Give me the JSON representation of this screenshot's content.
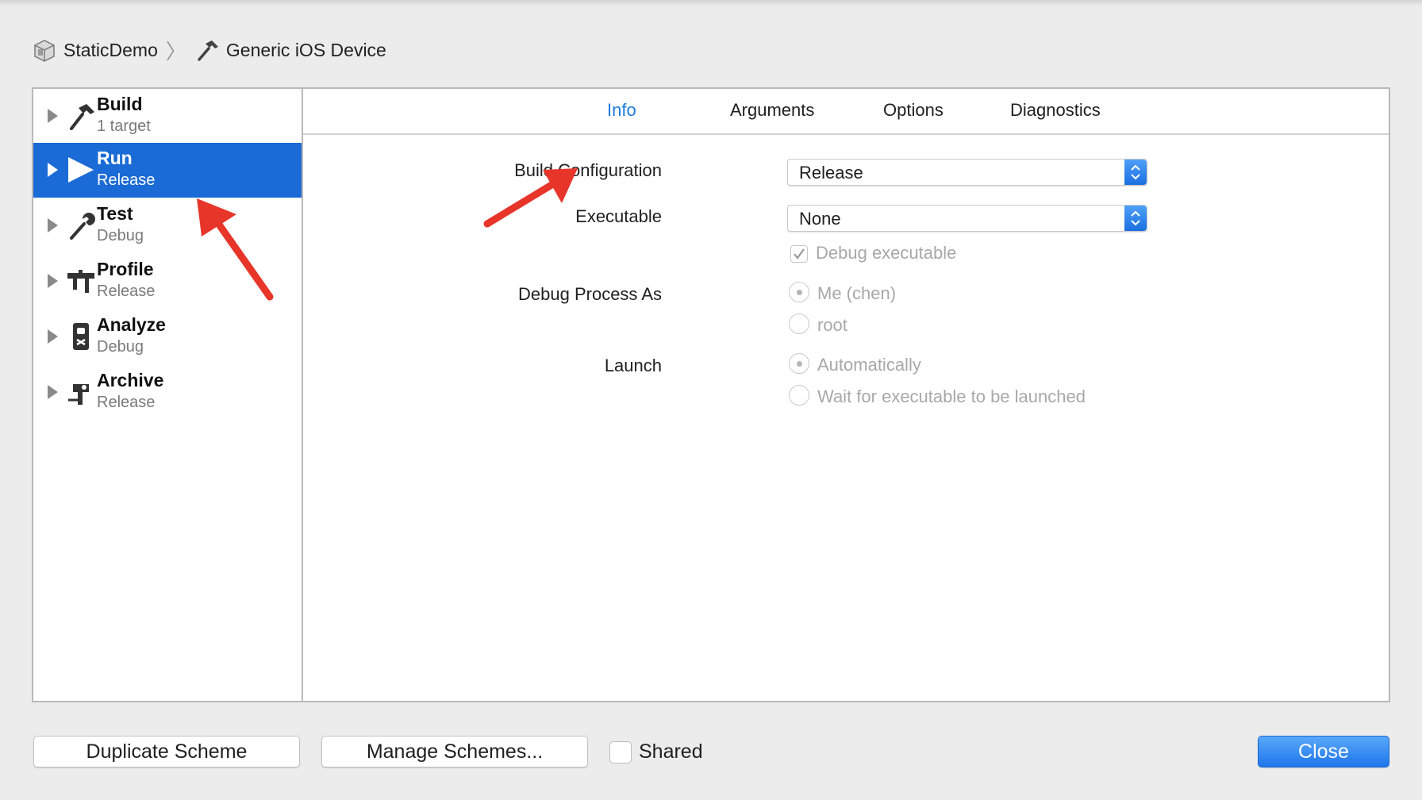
{
  "breadcrumb": {
    "project": "StaticDemo",
    "destination": "Generic iOS Device",
    "project_icon": "project-icon",
    "destination_icon": "hammer-icon"
  },
  "sidebar": {
    "items": [
      {
        "title": "Build",
        "subtitle": "1 target",
        "icon": "hammer-icon",
        "selected": false
      },
      {
        "title": "Run",
        "subtitle": "Release",
        "icon": "play-icon",
        "selected": true
      },
      {
        "title": "Test",
        "subtitle": "Debug",
        "icon": "wrench-icon",
        "selected": false
      },
      {
        "title": "Profile",
        "subtitle": "Release",
        "icon": "instruments-icon",
        "selected": false
      },
      {
        "title": "Analyze",
        "subtitle": "Debug",
        "icon": "analyze-icon",
        "selected": false
      },
      {
        "title": "Archive",
        "subtitle": "Release",
        "icon": "archive-icon",
        "selected": false
      }
    ]
  },
  "tabs": [
    {
      "label": "Info",
      "active": true
    },
    {
      "label": "Arguments",
      "active": false
    },
    {
      "label": "Options",
      "active": false
    },
    {
      "label": "Diagnostics",
      "active": false
    }
  ],
  "form": {
    "build_configuration": {
      "label": "Build Configuration",
      "value": "Release"
    },
    "executable": {
      "label": "Executable",
      "value": "None"
    },
    "debug_executable": {
      "label": "Debug executable",
      "checked": true
    },
    "debug_process_as": {
      "label": "Debug Process As",
      "options": [
        {
          "label": "Me (chen)",
          "selected": true
        },
        {
          "label": "root",
          "selected": false
        }
      ]
    },
    "launch": {
      "label": "Launch",
      "options": [
        {
          "label": "Automatically",
          "selected": true
        },
        {
          "label": "Wait for executable to be launched",
          "selected": false
        }
      ]
    }
  },
  "footer": {
    "duplicate_label": "Duplicate Scheme",
    "manage_label": "Manage Schemes...",
    "shared_label": "Shared",
    "shared_checked": false,
    "close_label": "Close"
  },
  "colors": {
    "accent": "#1a6bd6",
    "annotation_arrow": "#e8352a"
  }
}
